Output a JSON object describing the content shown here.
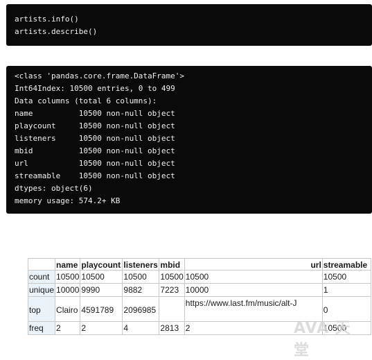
{
  "code_input": {
    "lines": [
      "artists.info()",
      "artists.describe()"
    ]
  },
  "code_output": {
    "lines": [
      "<class 'pandas.core.frame.DataFrame'>",
      "Int64Index: 10500 entries, 0 to 499",
      "Data columns (total 6 columns):",
      "name          10500 non-null object",
      "playcount     10500 non-null object",
      "listeners     10500 non-null object",
      "mbid          10500 non-null object",
      "url           10500 non-null object",
      "streamable    10500 non-null object",
      "dtypes: object(6)",
      "memory usage: 574.2+ KB"
    ]
  },
  "table": {
    "columns": [
      "name",
      "playcount",
      "listeners",
      "mbid",
      "url",
      "streamable"
    ],
    "rows": [
      {
        "index": "count",
        "cells": [
          "10500",
          "10500",
          "10500",
          "10500",
          "10500",
          "10500"
        ]
      },
      {
        "index": "unique",
        "cells": [
          "10000",
          "9990",
          "9882",
          "7223",
          "10000",
          "1"
        ]
      },
      {
        "index": "top",
        "cells": [
          "Clairo",
          "4591789",
          "2096985",
          "",
          "https://www.last.fm/music/alt-J",
          "0"
        ]
      },
      {
        "index": "freq",
        "cells": [
          "2",
          "2",
          "4",
          "2813",
          "2",
          "10500"
        ]
      }
    ]
  },
  "watermark": {
    "text": "AVA 天堂"
  }
}
